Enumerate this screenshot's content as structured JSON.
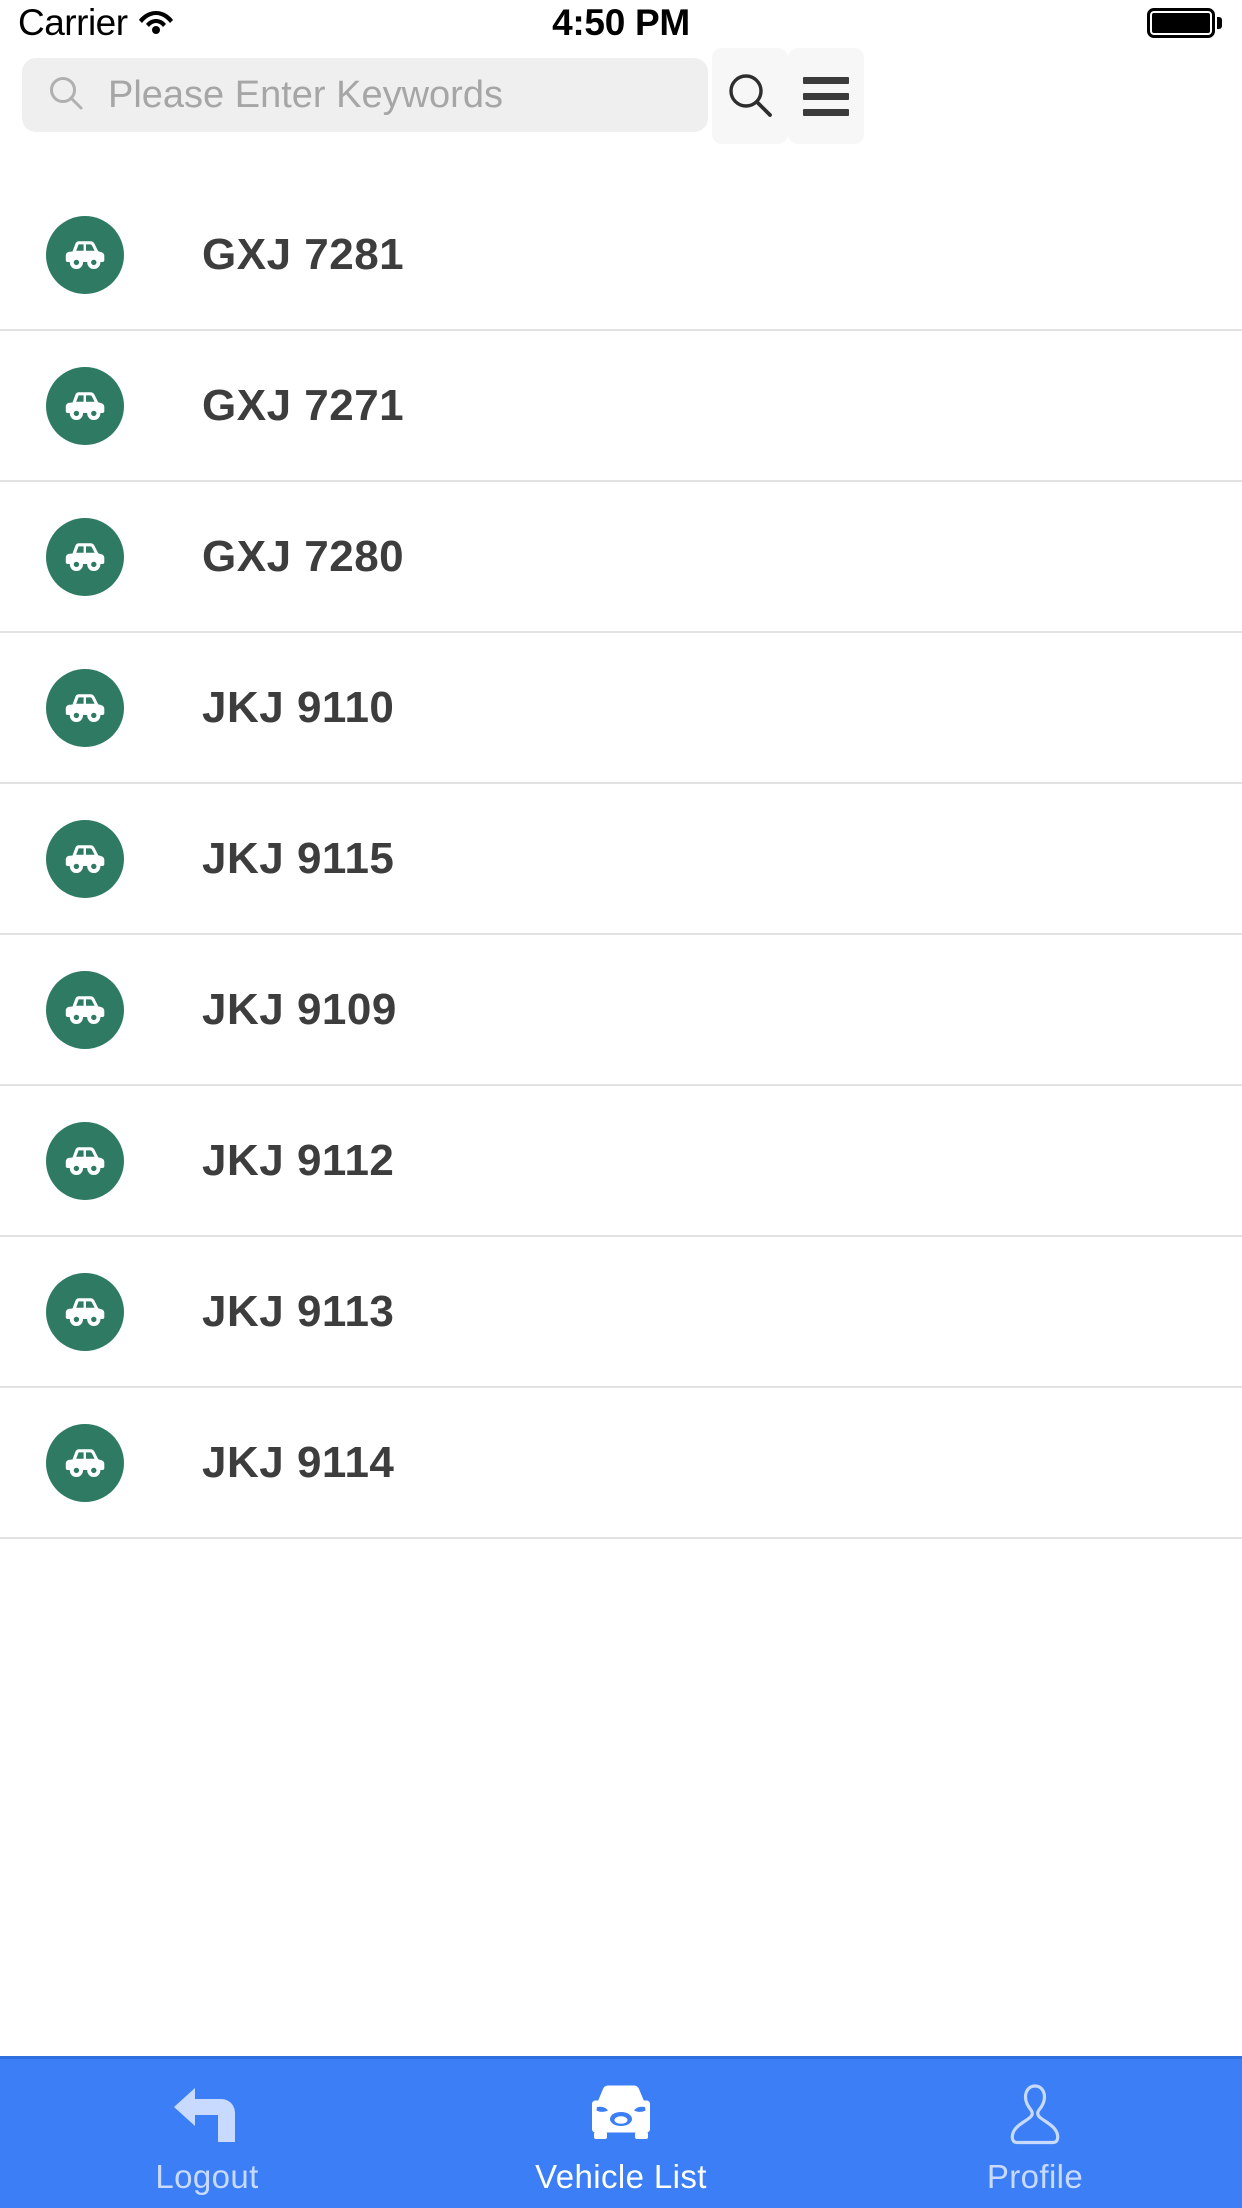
{
  "status_bar": {
    "carrier": "Carrier",
    "wifi_icon": "wifi-icon",
    "time": "4:50 PM",
    "battery_icon": "battery-full-icon"
  },
  "header": {
    "search": {
      "placeholder": "Please Enter Keywords",
      "value": "",
      "leading_icon": "search-icon"
    },
    "search_button": {
      "icon": "search-icon",
      "label": "Search"
    },
    "menu_button": {
      "icon": "hamburger-menu-icon",
      "label": "Menu"
    }
  },
  "vehicle_list": {
    "row_icon": "car-side-icon",
    "accent_color": "#2f7a63",
    "items": [
      {
        "plate": "GXJ 7281"
      },
      {
        "plate": "GXJ 7271"
      },
      {
        "plate": "GXJ 7280"
      },
      {
        "plate": "JKJ 9110"
      },
      {
        "plate": "JKJ 9115"
      },
      {
        "plate": "JKJ 9109"
      },
      {
        "plate": "JKJ 9112"
      },
      {
        "plate": "JKJ 9113"
      },
      {
        "plate": "JKJ 9114"
      }
    ]
  },
  "tab_bar": {
    "background_color": "#3b7ef5",
    "active_color": "#ffffff",
    "inactive_color": "#c8daff",
    "tabs": [
      {
        "label": "Logout",
        "icon": "back-arrow-icon",
        "active": false
      },
      {
        "label": "Vehicle List",
        "icon": "car-front-icon",
        "active": true
      },
      {
        "label": "Profile",
        "icon": "person-icon",
        "active": false
      }
    ]
  }
}
